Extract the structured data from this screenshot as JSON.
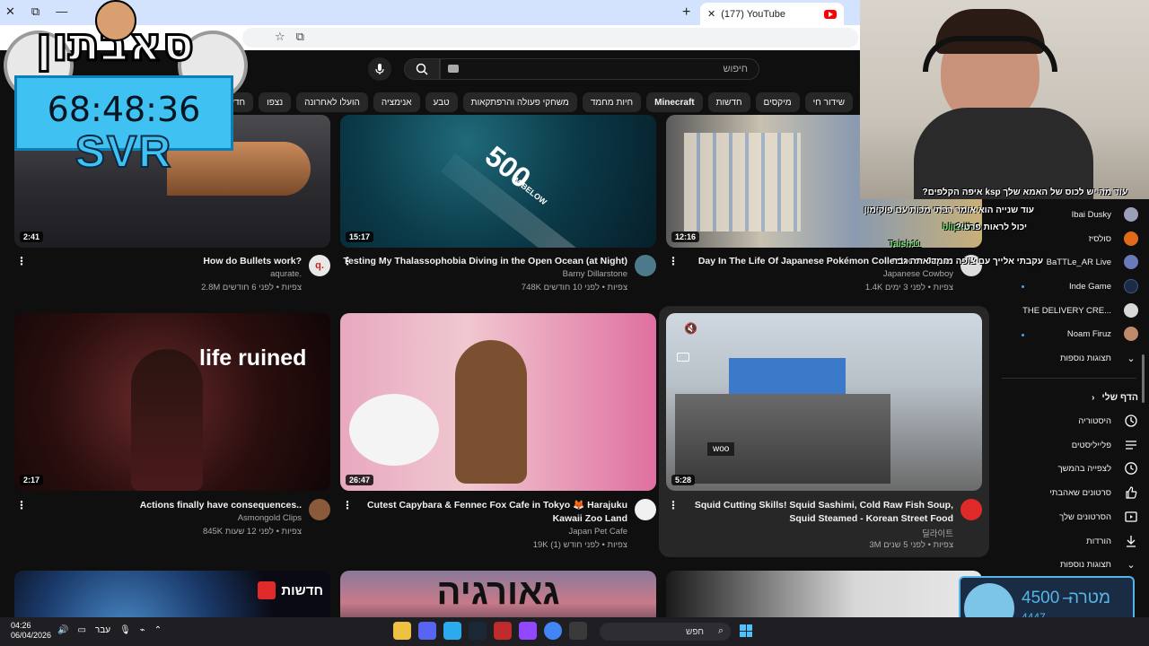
{
  "browser": {
    "tab_title": "(177) YouTube",
    "new_tab": "+",
    "window_controls": [
      "✕",
      "⧉",
      "—"
    ]
  },
  "youtube": {
    "search_placeholder": "חיפוש",
    "chips": [
      "שידור חי",
      "מיקסים",
      "חדשות",
      "Minecraft",
      "חיות מחמד",
      "משחקי פעולה והרפתקאות",
      "טבע",
      "אנימציה",
      "הועלו לאחרונה",
      "נצפו",
      "חדש בשבילך"
    ],
    "bold_chip": "Minecraft",
    "videos": [
      {
        "title": "How do Bullets work?",
        "channel": "aqurate.",
        "meta": "2.8M צפיות • לפני 6 חודשים",
        "duration": "2:41",
        "avatar_color": "#e8e8e8",
        "avatar_glyph": "q."
      },
      {
        "title": "Testing My Thalassophobia Diving in the Open Ocean (at Night)",
        "channel": "Barny Dillarstone",
        "meta": "748K צפיות • לפני 10 חודשים",
        "duration": "15:17",
        "avatar_color": "#4d7a8a",
        "thumb_text": "500",
        "thumb_sub": "M BELOW"
      },
      {
        "title": "Day In The Life Of Japanese Pokémon Collector In Japan",
        "channel": "Japanese Cowboy",
        "meta": "1.4K צפיות • לפני 3 ימים",
        "duration": "12:16",
        "avatar_color": "#dddddd"
      },
      {
        "title": "Actions finally have consequences..",
        "channel": "Asmongold Clips",
        "meta": "845K צפיות • לפני 12 שעות",
        "duration": "2:17",
        "avatar_color": "#8a5a3a",
        "thumb_text": "life ruined"
      },
      {
        "title": "Cutest Capybara & Fennec Fox Cafe in Tokyo 🦊 Harajuku Kawaii Zoo Land",
        "channel": "Japan Pet Cafe",
        "meta": "19K צפיות • לפני חודש (1)",
        "duration": "26:47",
        "avatar_color": "#f0f0f0"
      },
      {
        "title": "Squid Cutting Skills! Squid Sashimi, Cold Raw Fish Soup, Squid Steamed - Korean Street Food",
        "channel": "딜라이트",
        "meta": "3M צפיות • לפני 5 שנים",
        "duration": "5:28",
        "avatar_color": "#e02a2a",
        "thumb_caption": "woo"
      }
    ],
    "bottom_row": {
      "news_label": "חדשות",
      "banner_text": "גאורגיה"
    }
  },
  "sidebar": {
    "subscriptions": [
      {
        "label": "Ibai Dusky",
        "color": "#9aa0b8"
      },
      {
        "label": "סולסיז",
        "color": "#e06a1a"
      },
      {
        "label": "BaTTLe_AR Live",
        "color": "#6a7ab8"
      },
      {
        "label": "Inde Game",
        "color": "#1c2a44"
      },
      {
        "label": "THE DELIVERY CRE...",
        "color": "#d8d8d8"
      },
      {
        "label": "Noam Firuz",
        "color": "#c08a6a"
      }
    ],
    "show_more": "תצוגות נוספות",
    "my_section": "הדף שלי",
    "my_items": [
      {
        "label": "היסטוריה",
        "icon": "history-icon"
      },
      {
        "label": "פלייליסטים",
        "icon": "playlist-icon"
      },
      {
        "label": "לצפייה בהמשך",
        "icon": "clock-icon"
      },
      {
        "label": "סרטונים שאהבתי",
        "icon": "thumbs-up-icon"
      },
      {
        "label": "הסרטונים שלך",
        "icon": "video-icon"
      },
      {
        "label": "הורדות",
        "icon": "download-icon"
      }
    ],
    "show_more_2": "תצוגות נוספות"
  },
  "stream": {
    "timer": "68:48:36",
    "tag": "SVR",
    "logo": "סאבתון",
    "chat": [
      "?איפה הקלפים ksp עוד מה יש לכוס של האמא שלך",
      "עוד שנייה הוא אומר רבתי מכות עם פוקימון",
      "?יכול לראות פרטי",
      "עקבתי אלייך עם צופה נחמד אתה גבר"
    ],
    "chat_users": [
      "blipkilla9",
      "Taish11"
    ],
    "goal_label": "מטרה",
    "goal_value": "4500",
    "goal_current": "4447",
    "goal_dash": "–"
  },
  "taskbar": {
    "time": "04:26",
    "date": "06/04/2026",
    "lang": "עבר",
    "search": "חפש"
  }
}
